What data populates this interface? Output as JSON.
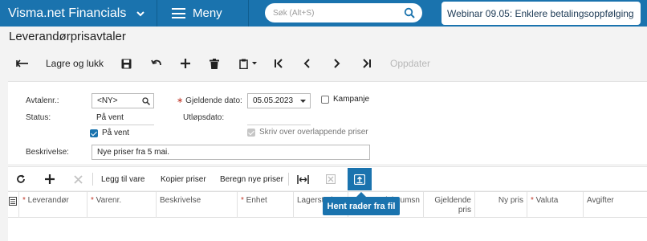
{
  "topbar": {
    "brand": "Visma.net Financials",
    "menu_label": "Meny",
    "search_placeholder": "Søk (Alt+S)",
    "webinar": "Webinar 09.05: Enklere betalingsoppfølging"
  },
  "page_title": "Leverandørprisavtaler",
  "toolbar": {
    "save_close": "Lagre og lukk",
    "update": "Oppdater"
  },
  "form": {
    "agreement_label": "Avtalenr.:",
    "agreement_value": "<NY>",
    "status_label": "Status:",
    "status_value": "På vent",
    "on_hold_label": "På vent",
    "on_hold_checked": true,
    "effective_date_label": "Gjeldende dato:",
    "effective_date_value": "05.05.2023",
    "expiry_label": "Utløpsdato:",
    "campaign_label": "Kampanje",
    "overwrite_label": "Skriv over overlappende priser",
    "description_label": "Beskrivelse:",
    "description_value": "Nye priser fra 5 mai."
  },
  "grid_toolbar": {
    "add_item": "Legg til vare",
    "copy_prices": "Kopier priser",
    "calc_prices": "Beregn nye priser"
  },
  "grid": {
    "columns": [
      "Leverandør",
      "Varenr.",
      "Beskrivelse",
      "Enhet",
      "Lagersted",
      "Minimumsn",
      "Gjeldende pris",
      "Ny pris",
      "Valuta",
      "Avgifter"
    ]
  },
  "tooltip": "Hent rader fra fil",
  "colors": {
    "brand_blue": "#1a73ae",
    "required_red": "#c0392b"
  }
}
